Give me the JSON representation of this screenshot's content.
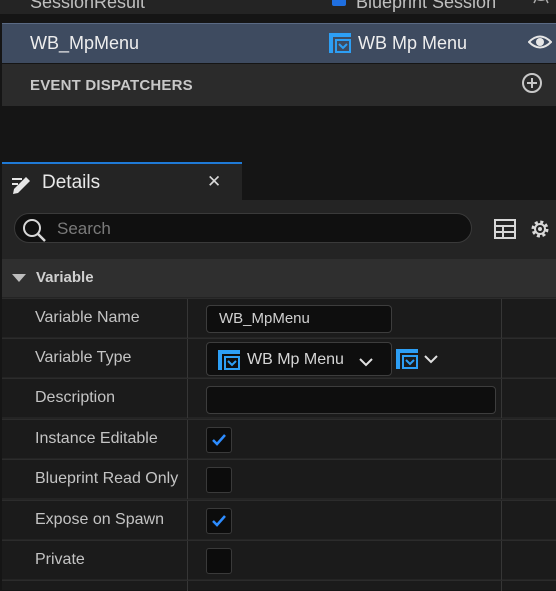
{
  "variables_list": {
    "rows": [
      {
        "name": "SessionResult",
        "type": "Blueprint Session",
        "icon": "struct-icon",
        "visibility_icon": "eye-closed-icon"
      },
      {
        "name": "WB_MpMenu",
        "type": "WB Mp Menu",
        "icon": "widget-blueprint-icon",
        "visibility_icon": "eye-icon",
        "selected": true
      }
    ],
    "event_dispatchers_label": "EVENT DISPATCHERS"
  },
  "details": {
    "tab_label": "Details",
    "search_placeholder": "Search",
    "category": "Variable",
    "properties": {
      "variable_name_label": "Variable Name",
      "variable_name_value": "WB_MpMenu",
      "variable_type_label": "Variable Type",
      "variable_type_value": "WB Mp Menu",
      "description_label": "Description",
      "description_value": "",
      "instance_editable_label": "Instance Editable",
      "instance_editable_checked": true,
      "blueprint_read_only_label": "Blueprint Read Only",
      "blueprint_read_only_checked": false,
      "expose_on_spawn_label": "Expose on Spawn",
      "expose_on_spawn_checked": true,
      "private_label": "Private",
      "private_checked": false
    }
  },
  "colors": {
    "accent": "#1f7ad6",
    "selected_row": "#3e4b60",
    "check": "#2d8cff"
  }
}
